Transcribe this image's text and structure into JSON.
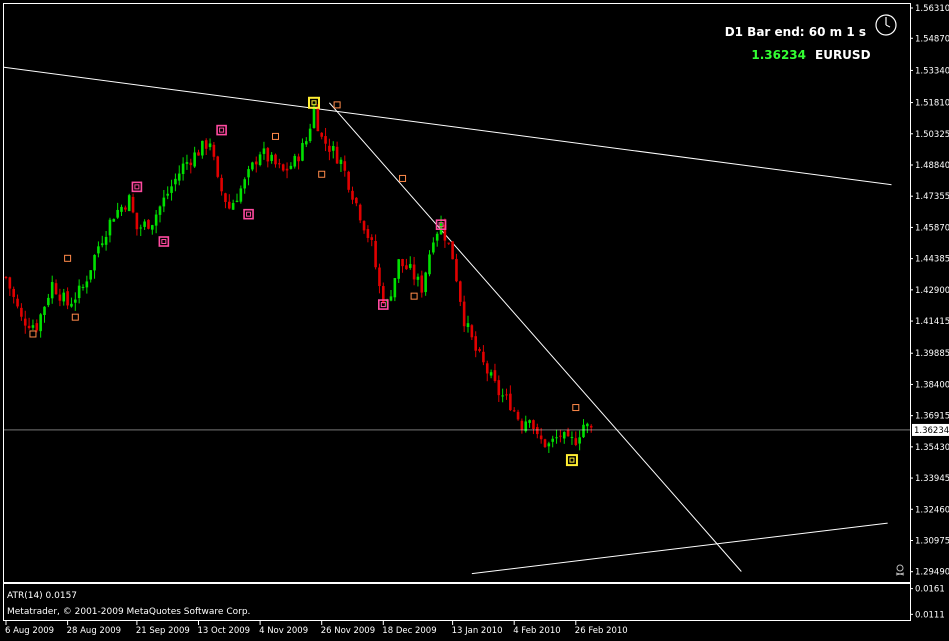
{
  "app": {
    "symbol": "EURUSD",
    "bid": "1.36234",
    "bar_end": "D1 Bar end: 60 m 1 s",
    "current_price_label": "1.36234"
  },
  "colors": {
    "background": "#000000",
    "bull": "#00e000",
    "bear": "#e00000",
    "axis": "#ffffff",
    "grid": "#ffffff",
    "bid_green": "#33ff33",
    "fractal_major": "#ff4aa0",
    "fractal_minor": "#ff8a4a",
    "fractal_extreme": "#ffee33"
  },
  "icons": {
    "clock": "clock-icon",
    "skull": "skull-icon"
  },
  "chart_data": {
    "type": "candlestick",
    "symbol": "EURUSD",
    "timeframe": "D1",
    "ylim": [
      1.29,
      1.565
    ],
    "price_ticks": [
      "1.56310",
      "1.54870",
      "1.53340",
      "1.51810",
      "1.50325",
      "1.48840",
      "1.47355",
      "1.45870",
      "1.44385",
      "1.42900",
      "1.41415",
      "1.39885",
      "1.38400",
      "1.36915",
      "1.35430",
      "1.33945",
      "1.32460",
      "1.30975",
      "1.29490"
    ],
    "price_tick_values": [
      1.5631,
      1.5487,
      1.5334,
      1.5181,
      1.50325,
      1.4884,
      1.47355,
      1.4587,
      1.44385,
      1.429,
      1.41415,
      1.39885,
      1.384,
      1.36915,
      1.3543,
      1.33945,
      1.3246,
      1.30975,
      1.2949
    ],
    "date_ticks": [
      "6 Aug 2009",
      "28 Aug 2009",
      "21 Sep 2009",
      "13 Oct 2009",
      "4 Nov 2009",
      "26 Nov 2009",
      "18 Dec 2009",
      "13 Jan 2010",
      "4 Feb 2010",
      "26 Feb 2010"
    ],
    "date_tick_bars": [
      0,
      16,
      34,
      50,
      66,
      82,
      98,
      116,
      132,
      148
    ],
    "close_path": [
      [
        0,
        1.435
      ],
      [
        4,
        1.415
      ],
      [
        8,
        1.412
      ],
      [
        12,
        1.432
      ],
      [
        16,
        1.422
      ],
      [
        20,
        1.43
      ],
      [
        24,
        1.45
      ],
      [
        28,
        1.465
      ],
      [
        32,
        1.472
      ],
      [
        34,
        1.458
      ],
      [
        38,
        1.462
      ],
      [
        42,
        1.475
      ],
      [
        46,
        1.488
      ],
      [
        50,
        1.495
      ],
      [
        53,
        1.5
      ],
      [
        55,
        1.48
      ],
      [
        58,
        1.468
      ],
      [
        62,
        1.48
      ],
      [
        66,
        1.495
      ],
      [
        69,
        1.49
      ],
      [
        72,
        1.485
      ],
      [
        75,
        1.49
      ],
      [
        78,
        1.5
      ],
      [
        80,
        1.515
      ],
      [
        82,
        1.501
      ],
      [
        85,
        1.495
      ],
      [
        87,
        1.49
      ],
      [
        89,
        1.48
      ],
      [
        92,
        1.465
      ],
      [
        95,
        1.45
      ],
      [
        97,
        1.43
      ],
      [
        99,
        1.422
      ],
      [
        102,
        1.442
      ],
      [
        105,
        1.438
      ],
      [
        108,
        1.43
      ],
      [
        111,
        1.455
      ],
      [
        113,
        1.46
      ],
      [
        116,
        1.445
      ],
      [
        119,
        1.415
      ],
      [
        122,
        1.4
      ],
      [
        125,
        1.39
      ],
      [
        128,
        1.38
      ],
      [
        131,
        1.375
      ],
      [
        134,
        1.365
      ],
      [
        136,
        1.37
      ],
      [
        138,
        1.358
      ],
      [
        141,
        1.355
      ],
      [
        144,
        1.36
      ],
      [
        146,
        1.356
      ],
      [
        148,
        1.358
      ],
      [
        150,
        1.365
      ],
      [
        152,
        1.3623
      ]
    ],
    "fractals_major": [
      {
        "bar": 34,
        "price": 1.478,
        "side": "high"
      },
      {
        "bar": 41,
        "price": 1.452,
        "side": "low"
      },
      {
        "bar": 56,
        "price": 1.505,
        "side": "high"
      },
      {
        "bar": 63,
        "price": 1.465,
        "side": "low"
      },
      {
        "bar": 98,
        "price": 1.422,
        "side": "low"
      },
      {
        "bar": 113,
        "price": 1.46,
        "side": "high"
      }
    ],
    "fractals_minor": [
      {
        "bar": 7,
        "price": 1.408
      },
      {
        "bar": 16,
        "price": 1.444
      },
      {
        "bar": 18,
        "price": 1.416
      },
      {
        "bar": 70,
        "price": 1.502
      },
      {
        "bar": 82,
        "price": 1.484
      },
      {
        "bar": 86,
        "price": 1.517
      },
      {
        "bar": 103,
        "price": 1.482
      },
      {
        "bar": 106,
        "price": 1.426
      },
      {
        "bar": 148,
        "price": 1.373
      }
    ],
    "fractals_extreme": [
      {
        "bar": 80,
        "price": 1.518
      },
      {
        "bar": 147,
        "price": 1.348
      }
    ],
    "trendlines": [
      {
        "from": [
          -1,
          1.535
        ],
        "to": [
          230,
          1.479
        ]
      },
      {
        "from": [
          84,
          1.518
        ],
        "to": [
          191,
          1.295
        ]
      },
      {
        "from": [
          121,
          1.294
        ],
        "to": [
          229,
          1.318
        ]
      }
    ],
    "current_price": 1.36234
  },
  "indicator": {
    "label": "ATR(14) 0.0157",
    "copyright": "Metatrader, © 2001-2009 MetaQuotes Software Corp.",
    "ticks": [
      "0.0161",
      "0.0111"
    ],
    "tick_values": [
      0.0161,
      0.0111
    ],
    "ylim": [
      0.01,
      0.017
    ],
    "value": 0.0157
  }
}
